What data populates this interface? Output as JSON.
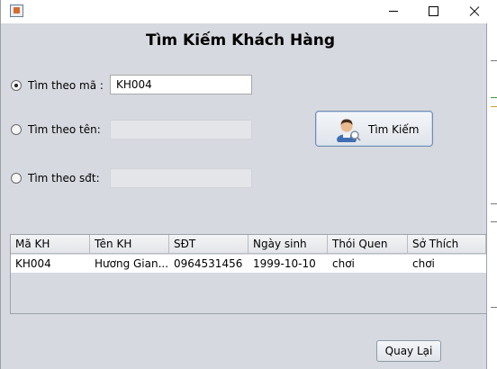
{
  "window": {
    "title": "",
    "controls": [
      "minimize-icon",
      "maximize-icon",
      "close-icon"
    ]
  },
  "heading": "Tìm Kiếm Khách Hàng",
  "search_options": [
    {
      "label": "Tìm theo mã :",
      "selected": true,
      "value": "KH004",
      "enabled": true
    },
    {
      "label": "Tìm theo tên:",
      "selected": false,
      "value": "",
      "enabled": false
    },
    {
      "label": "Tìm theo sđt:",
      "selected": false,
      "value": "",
      "enabled": false
    }
  ],
  "search_button": {
    "label": "Tìm Kiếm",
    "icon": "user-search-icon"
  },
  "table": {
    "columns": [
      "Mã KH",
      "Tên KH",
      "SĐT",
      "Ngày sinh",
      "Thói Quen",
      "Sở Thích"
    ],
    "rows": [
      [
        "KH004",
        "Hương Gian...",
        "0964531456",
        "1999-10-10",
        "chơi",
        "chơi"
      ]
    ]
  },
  "back_button": {
    "label": "Quay Lại"
  },
  "colors": {
    "window_bg": "#d6d9df",
    "button_border": "#6f8cb3"
  }
}
